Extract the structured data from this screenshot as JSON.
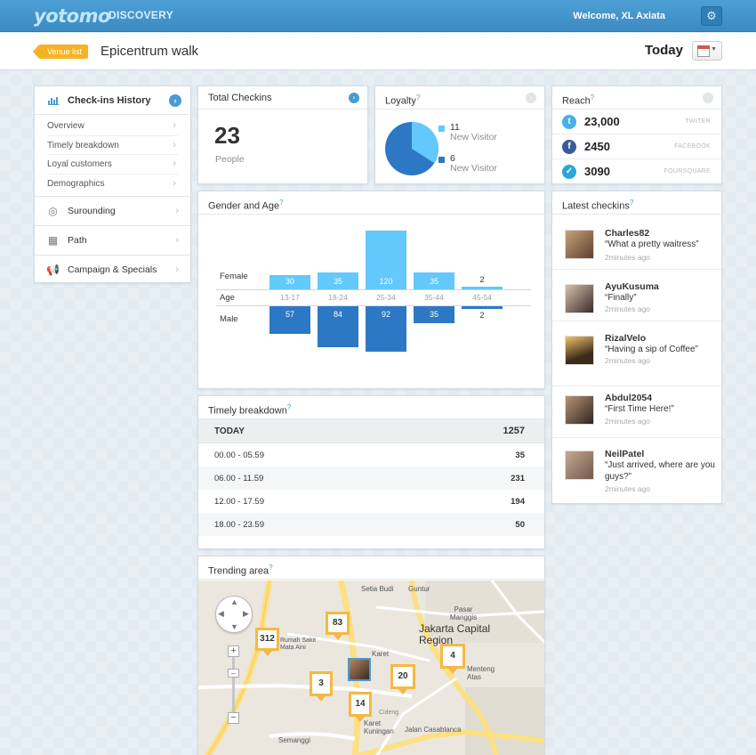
{
  "header": {
    "logo": "yotomo",
    "logo_sub": "DISCOVERY",
    "welcome": "Welcome, XL Axiata",
    "settings_icon": "gear-icon"
  },
  "subbar": {
    "venue_tag": "Venue list",
    "venue_title": "Epicentrum walk",
    "date_label": "Today",
    "calendar_icon": "calendar-icon"
  },
  "sidebar": {
    "head": "Check-ins History",
    "sub_items": [
      "Overview",
      "Timely breakdown",
      "Loyal customers",
      "Demographics"
    ],
    "items": [
      "Surounding",
      "Path",
      "Campaign & Specials"
    ]
  },
  "total_checkins": {
    "title": "Total Checkins",
    "value": "23",
    "unit": "People"
  },
  "loyalty": {
    "title": "Loyalty",
    "q": "?",
    "colors": {
      "returning": "#63c8fb",
      "new": "#2d78c4"
    },
    "entries": [
      {
        "count": "11",
        "label": "New Visitor"
      },
      {
        "count": "6",
        "label": "New Visitor"
      }
    ]
  },
  "reach": {
    "title": "Reach",
    "q": "?",
    "rows": [
      {
        "value": "23,000",
        "source": "TWITER",
        "icon": "twitter-icon"
      },
      {
        "value": "2450",
        "source": "FACEBOOK",
        "icon": "facebook-icon"
      },
      {
        "value": "3090",
        "source": "FOURSQUARE",
        "icon": "foursquare-icon"
      }
    ]
  },
  "gender_age": {
    "title": "Gender and Age",
    "q": "?",
    "female_label": "Female",
    "age_label": "Age",
    "male_label": "Male"
  },
  "chart_data": {
    "type": "bar",
    "categories": [
      "13-17",
      "18-24",
      "25-34",
      "35-44",
      "45-54"
    ],
    "series": [
      {
        "name": "Female",
        "values": [
          30,
          35,
          120,
          35,
          2
        ]
      },
      {
        "name": "Male",
        "values": [
          57,
          84,
          92,
          35,
          2
        ]
      }
    ],
    "title": "Gender and Age",
    "xlabel": "Age",
    "ylabel": ""
  },
  "timely": {
    "title": "Timely breakdown",
    "q": "?",
    "today_label": "TODAY",
    "today_total": "1257",
    "rows": [
      {
        "range": "00.00 - 05.59",
        "value": "35"
      },
      {
        "range": "06.00 - 11.59",
        "value": "231"
      },
      {
        "range": "12.00 - 17.59",
        "value": "194"
      },
      {
        "range": "18.00 - 23.59",
        "value": "50"
      }
    ]
  },
  "latest": {
    "title": "Latest checkins",
    "q": "?",
    "items": [
      {
        "name": "Charles82",
        "msg": "“What a pretty waitress”",
        "time": "2minutes ago"
      },
      {
        "name": "AyuKusuma",
        "msg": "“Finally”",
        "time": "2minutes ago"
      },
      {
        "name": "RizalVelo",
        "msg": "“Having a sip of Coffee”",
        "time": "2minutes ago"
      },
      {
        "name": "Abdul2054",
        "msg": "“First Time Here!”",
        "time": "2minutes ago"
      },
      {
        "name": "NeilPatel",
        "msg": "“Just arrived, where are you guys?”",
        "time": "2minutes ago"
      }
    ]
  },
  "trending": {
    "title": "Trending area",
    "q": "?",
    "pins": [
      "312",
      "83",
      "3",
      "14",
      "20",
      "4"
    ],
    "places": [
      "Setia Budi",
      "Guntur",
      "Pasar Manggis",
      "Jakarta Capital Region",
      "Menteng Atas",
      "Karet Kuningan",
      "Semanggi",
      "Jalan Casablanca",
      "Karet",
      "Rumah Sakit Mata Aini",
      "Cideng"
    ]
  }
}
